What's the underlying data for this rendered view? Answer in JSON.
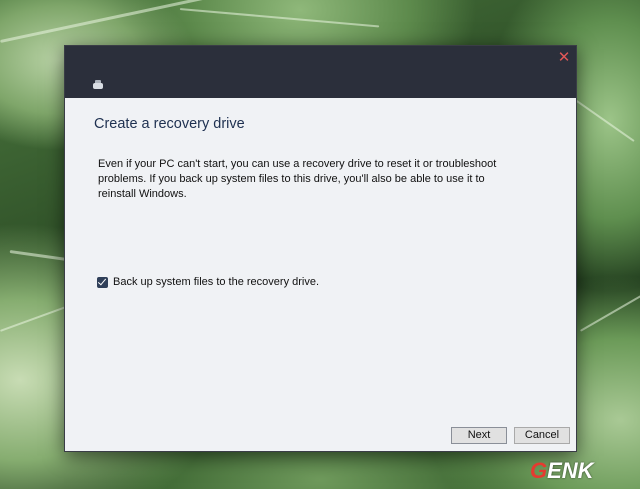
{
  "window": {
    "title": "Create a recovery drive",
    "description": "Even if your PC can't start, you can use a recovery drive to reset it or troubleshoot problems. If you back up system files to this drive, you'll also be able to use it to reinstall Windows.",
    "close_symbol": "✕"
  },
  "options": {
    "backup_label": "Back up system files to the recovery drive.",
    "backup_checked": true
  },
  "buttons": {
    "next_label": "Next",
    "cancel_label": "Cancel"
  },
  "watermark": {
    "first": "G",
    "rest": "ENK"
  },
  "colors": {
    "titlebar": "#2b2f3b",
    "window_bg": "#f0f2f5",
    "title_text": "#1e3050",
    "close": "#e05757",
    "watermark_red": "#e53a30"
  },
  "icons": {
    "app": "recovery-drive-icon",
    "close": "close-icon",
    "checkbox": "checkmark-icon"
  }
}
